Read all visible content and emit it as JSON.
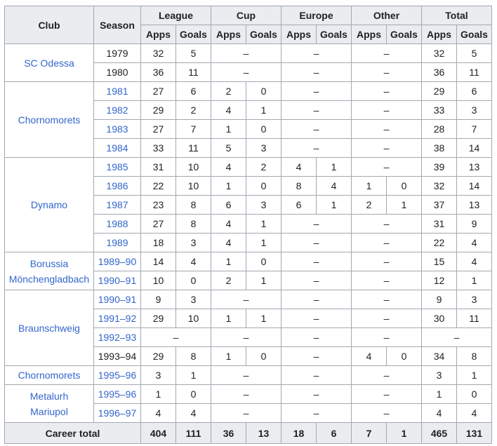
{
  "headers": {
    "club": "Club",
    "season": "Season",
    "groups": [
      "League",
      "Cup",
      "Europe",
      "Other",
      "Total"
    ],
    "apps": "Apps",
    "goals": "Goals"
  },
  "dash": "–",
  "clubs": [
    {
      "name_lines": [
        "SC Odessa"
      ],
      "seasons": [
        {
          "season": "1979",
          "link": false,
          "league": [
            "32",
            "5"
          ],
          "cup": "–",
          "europe": "–",
          "other": "–",
          "total": [
            "32",
            "5"
          ]
        },
        {
          "season": "1980",
          "link": false,
          "league": [
            "36",
            "11"
          ],
          "cup": "–",
          "europe": "–",
          "other": "–",
          "total": [
            "36",
            "11"
          ]
        }
      ]
    },
    {
      "name_lines": [
        "Chornomorets"
      ],
      "seasons": [
        {
          "season": "1981",
          "link": true,
          "league": [
            "27",
            "6"
          ],
          "cup": [
            "2",
            "0"
          ],
          "europe": "–",
          "other": "–",
          "total": [
            "29",
            "6"
          ]
        },
        {
          "season": "1982",
          "link": true,
          "league": [
            "29",
            "2"
          ],
          "cup": [
            "4",
            "1"
          ],
          "europe": "–",
          "other": "–",
          "total": [
            "33",
            "3"
          ]
        },
        {
          "season": "1983",
          "link": true,
          "league": [
            "27",
            "7"
          ],
          "cup": [
            "1",
            "0"
          ],
          "europe": "–",
          "other": "–",
          "total": [
            "28",
            "7"
          ]
        },
        {
          "season": "1984",
          "link": true,
          "league": [
            "33",
            "11"
          ],
          "cup": [
            "5",
            "3"
          ],
          "europe": "–",
          "other": "–",
          "total": [
            "38",
            "14"
          ]
        }
      ]
    },
    {
      "name_lines": [
        "Dynamo"
      ],
      "seasons": [
        {
          "season": "1985",
          "link": true,
          "league": [
            "31",
            "10"
          ],
          "cup": [
            "4",
            "2"
          ],
          "europe": [
            "4",
            "1"
          ],
          "other": "–",
          "total": [
            "39",
            "13"
          ]
        },
        {
          "season": "1986",
          "link": true,
          "league": [
            "22",
            "10"
          ],
          "cup": [
            "1",
            "0"
          ],
          "europe": [
            "8",
            "4"
          ],
          "other": [
            "1",
            "0"
          ],
          "total": [
            "32",
            "14"
          ]
        },
        {
          "season": "1987",
          "link": true,
          "league": [
            "23",
            "8"
          ],
          "cup": [
            "6",
            "3"
          ],
          "europe": [
            "6",
            "1"
          ],
          "other": [
            "2",
            "1"
          ],
          "total": [
            "37",
            "13"
          ]
        },
        {
          "season": "1988",
          "link": true,
          "league": [
            "27",
            "8"
          ],
          "cup": [
            "4",
            "1"
          ],
          "europe": "–",
          "other": "–",
          "total": [
            "31",
            "9"
          ]
        },
        {
          "season": "1989",
          "link": true,
          "league": [
            "18",
            "3"
          ],
          "cup": [
            "4",
            "1"
          ],
          "europe": "–",
          "other": "–",
          "total": [
            "22",
            "4"
          ]
        }
      ]
    },
    {
      "name_lines": [
        "Borussia",
        "Mönchengladbach"
      ],
      "seasons": [
        {
          "season": "1989–90",
          "link": true,
          "league": [
            "14",
            "4"
          ],
          "cup": [
            "1",
            "0"
          ],
          "europe": "–",
          "other": "–",
          "total": [
            "15",
            "4"
          ]
        },
        {
          "season": "1990–91",
          "link": true,
          "league": [
            "10",
            "0"
          ],
          "cup": [
            "2",
            "1"
          ],
          "europe": "–",
          "other": "–",
          "total": [
            "12",
            "1"
          ]
        }
      ]
    },
    {
      "name_lines": [
        "Braunschweig"
      ],
      "seasons": [
        {
          "season": "1990–91",
          "link": true,
          "league": [
            "9",
            "3"
          ],
          "cup": "–",
          "europe": "–",
          "other": "–",
          "total": [
            "9",
            "3"
          ]
        },
        {
          "season": "1991–92",
          "link": true,
          "league": [
            "29",
            "10"
          ],
          "cup": [
            "1",
            "1"
          ],
          "europe": "–",
          "other": "–",
          "total": [
            "30",
            "11"
          ]
        },
        {
          "season": "1992–93",
          "link": true,
          "league": "–",
          "cup": "–",
          "europe": "–",
          "other": "–",
          "total": "–"
        },
        {
          "season": "1993–94",
          "link": false,
          "league": [
            "29",
            "8"
          ],
          "cup": [
            "1",
            "0"
          ],
          "europe": "–",
          "other": [
            "4",
            "0"
          ],
          "total": [
            "34",
            "8"
          ]
        }
      ]
    },
    {
      "name_lines": [
        "Chornomorets"
      ],
      "seasons": [
        {
          "season": "1995–96",
          "link": true,
          "league": [
            "3",
            "1"
          ],
          "cup": "–",
          "europe": "–",
          "other": "–",
          "total": [
            "3",
            "1"
          ]
        }
      ]
    },
    {
      "name_lines": [
        "Metalurh",
        "Mariupol"
      ],
      "seasons": [
        {
          "season": "1995–96",
          "link": true,
          "league": [
            "1",
            "0"
          ],
          "cup": "–",
          "europe": "–",
          "other": "–",
          "total": [
            "1",
            "0"
          ]
        },
        {
          "season": "1996–97",
          "link": true,
          "league": [
            "4",
            "4"
          ],
          "cup": "–",
          "europe": "–",
          "other": "–",
          "total": [
            "4",
            "4"
          ]
        }
      ]
    }
  ],
  "career_total": {
    "label": "Career total",
    "values": [
      "404",
      "111",
      "36",
      "13",
      "18",
      "6",
      "7",
      "1",
      "465",
      "131"
    ]
  }
}
